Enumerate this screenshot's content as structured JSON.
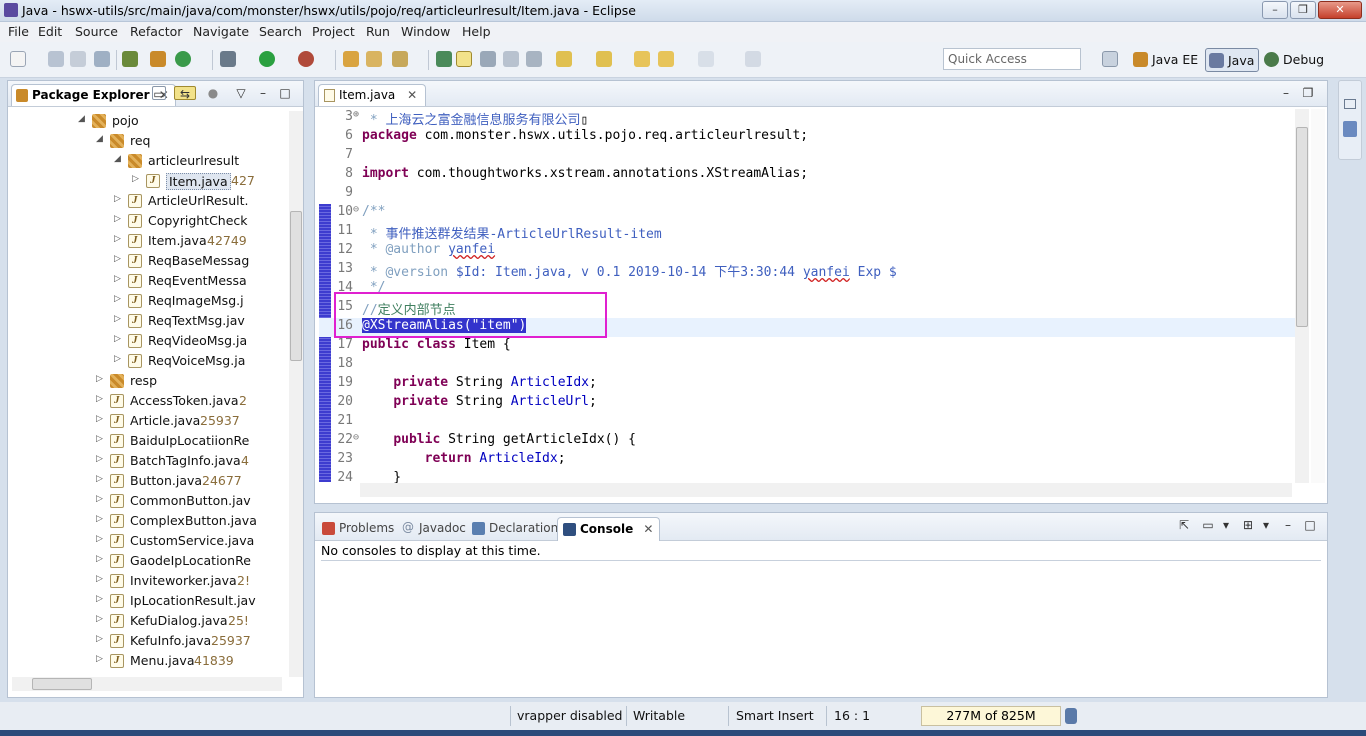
{
  "window": {
    "title": "Java - hswx-utils/src/main/java/com/monster/hswx/utils/pojo/req/articleurlresult/Item.java - Eclipse",
    "controls": {
      "minimize": "–",
      "maximize": "❐",
      "close": "✕"
    }
  },
  "menu": [
    "File",
    "Edit",
    "Source",
    "Refactor",
    "Navigate",
    "Search",
    "Project",
    "Run",
    "Window",
    "Help"
  ],
  "quick_access": {
    "placeholder": "Quick Access"
  },
  "perspectives": [
    {
      "label": "Java EE",
      "active": false
    },
    {
      "label": "Java",
      "active": true
    },
    {
      "label": "Debug",
      "active": false
    }
  ],
  "package_explorer": {
    "title": "Package Explorer",
    "items": [
      {
        "label": "pojo",
        "meta": "",
        "kind": "pkg",
        "arrow": "◢",
        "indent": 1
      },
      {
        "label": "req",
        "meta": "",
        "kind": "pkg",
        "arrow": "◢",
        "indent": 2
      },
      {
        "label": "articleurlresult",
        "meta": "",
        "kind": "pkg",
        "arrow": "◢",
        "indent": 3
      },
      {
        "label": "Item.java",
        "meta": " 427",
        "kind": "jf",
        "arrow": "▷",
        "indent": 4,
        "selected": true
      },
      {
        "label": "ArticleUrlResult.",
        "meta": "",
        "kind": "jf",
        "arrow": "▷",
        "indent": 3
      },
      {
        "label": "CopyrightCheck",
        "meta": "",
        "kind": "jf",
        "arrow": "▷",
        "indent": 3
      },
      {
        "label": "Item.java",
        "meta": " 42749",
        "kind": "jf",
        "arrow": "▷",
        "indent": 3
      },
      {
        "label": "ReqBaseMessag",
        "meta": "",
        "kind": "jf",
        "arrow": "▷",
        "indent": 3
      },
      {
        "label": "ReqEventMessa",
        "meta": "",
        "kind": "jf",
        "arrow": "▷",
        "indent": 3
      },
      {
        "label": "ReqImageMsg.j",
        "meta": "",
        "kind": "jf",
        "arrow": "▷",
        "indent": 3
      },
      {
        "label": "ReqTextMsg.jav",
        "meta": "",
        "kind": "jf",
        "arrow": "▷",
        "indent": 3
      },
      {
        "label": "ReqVideoMsg.ja",
        "meta": "",
        "kind": "jf",
        "arrow": "▷",
        "indent": 3
      },
      {
        "label": "ReqVoiceMsg.ja",
        "meta": "",
        "kind": "jf",
        "arrow": "▷",
        "indent": 3
      },
      {
        "label": "resp",
        "meta": "",
        "kind": "pkg",
        "arrow": "▷",
        "indent": 2
      },
      {
        "label": "AccessToken.java",
        "meta": " 2",
        "kind": "jf",
        "arrow": "▷",
        "indent": 2
      },
      {
        "label": "Article.java",
        "meta": " 25937",
        "kind": "jf",
        "arrow": "▷",
        "indent": 2
      },
      {
        "label": "BaiduIpLocatiionRe",
        "meta": "",
        "kind": "jf",
        "arrow": "▷",
        "indent": 2
      },
      {
        "label": "BatchTagInfo.java",
        "meta": " 4",
        "kind": "jf",
        "arrow": "▷",
        "indent": 2
      },
      {
        "label": "Button.java",
        "meta": " 24677",
        "kind": "jf",
        "arrow": "▷",
        "indent": 2
      },
      {
        "label": "CommonButton.jav",
        "meta": "",
        "kind": "jf",
        "arrow": "▷",
        "indent": 2
      },
      {
        "label": "ComplexButton.java",
        "meta": "",
        "kind": "jf",
        "arrow": "▷",
        "indent": 2
      },
      {
        "label": "CustomService.java",
        "meta": "",
        "kind": "jf",
        "arrow": "▷",
        "indent": 2
      },
      {
        "label": "GaodeIpLocationRe",
        "meta": "",
        "kind": "jf",
        "arrow": "▷",
        "indent": 2
      },
      {
        "label": "Inviteworker.java",
        "meta": " 2!",
        "kind": "jf",
        "arrow": "▷",
        "indent": 2
      },
      {
        "label": "IpLocationResult.jav",
        "meta": "",
        "kind": "jf",
        "arrow": "▷",
        "indent": 2
      },
      {
        "label": "KefuDialog.java",
        "meta": " 25!",
        "kind": "jf",
        "arrow": "▷",
        "indent": 2
      },
      {
        "label": "KefuInfo.java",
        "meta": " 25937",
        "kind": "jf",
        "arrow": "▷",
        "indent": 2
      },
      {
        "label": "Menu.java",
        "meta": " 41839",
        "kind": "jf",
        "arrow": "▷",
        "indent": 2
      }
    ]
  },
  "editor": {
    "tab_label": "Item.java",
    "lines": [
      {
        "n": "3",
        "fold": "⊕",
        "html": "<span class=\"jd\"> * </span><span class=\"cm\">上海云之富金融信息服务有限公司</span>▯"
      },
      {
        "n": "6",
        "fold": "",
        "html": "<span class=\"kw\">package</span> com.monster.hswx.utils.pojo.req.articleurlresult;"
      },
      {
        "n": "7",
        "fold": "",
        "html": ""
      },
      {
        "n": "8",
        "fold": "",
        "html": "<span class=\"kw\">import</span> com.thoughtworks.xstream.annotations.XStreamAlias;"
      },
      {
        "n": "9",
        "fold": "",
        "html": ""
      },
      {
        "n": "10",
        "fold": "⊖",
        "html": "<span class=\"jd\">/**</span>"
      },
      {
        "n": "11",
        "fold": "",
        "html": "<span class=\"jd\"> * </span><span class=\"cm\">事件推送群发结果-ArticleUrlResult-item</span>"
      },
      {
        "n": "12",
        "fold": "",
        "html": "<span class=\"jd\"> * @author </span><span class=\"cm squig\">yanfei</span>"
      },
      {
        "n": "13",
        "fold": "",
        "html": "<span class=\"jd\"> * @version </span><span class=\"cm\">$Id: Item.java, v 0.1 2019-10-14 下午3:30:44 <span class=\"squig\">yanfei</span> Exp $</span>"
      },
      {
        "n": "14",
        "fold": "",
        "html": "<span class=\"jd\"> */</span>"
      },
      {
        "n": "15",
        "fold": "",
        "html": "<span class=\"jd\">//</span><span style=\"color:#3f7f5f\">定义内部节点</span>"
      },
      {
        "n": "16",
        "fold": "",
        "html": "<span class=\"sel\">@XStreamAlias(\"item\")</span>",
        "current": true
      },
      {
        "n": "17",
        "fold": "",
        "html": "<span class=\"kw\">public class</span> Item {"
      },
      {
        "n": "18",
        "fold": "",
        "html": ""
      },
      {
        "n": "19",
        "fold": "",
        "html": "    <span class=\"kw\">private</span> String <span class=\"field\">ArticleIdx</span>;"
      },
      {
        "n": "20",
        "fold": "",
        "html": "    <span class=\"kw\">private</span> String <span class=\"field\">ArticleUrl</span>;"
      },
      {
        "n": "21",
        "fold": "",
        "html": ""
      },
      {
        "n": "22",
        "fold": "⊖",
        "html": "    <span class=\"kw\">public</span> String getArticleIdx() {"
      },
      {
        "n": "23",
        "fold": "",
        "html": "        <span class=\"kw\">return</span> <span class=\"field\">ArticleIdx</span>;"
      },
      {
        "n": "24",
        "fold": "",
        "html": "    }"
      }
    ]
  },
  "console": {
    "tabs": [
      {
        "label": "Problems",
        "active": false,
        "color": "#c94a3a"
      },
      {
        "label": "Javadoc",
        "active": false,
        "color": "#7a8aa0"
      },
      {
        "label": "Declaration",
        "active": false,
        "color": "#5a7fb0"
      },
      {
        "label": "Console",
        "active": true,
        "color": "#2f4f7f"
      }
    ],
    "message": "No consoles to display at this time."
  },
  "status": {
    "wrapper": "vrapper disabled",
    "mode": "Writable",
    "insert": "Smart Insert",
    "position": "16 : 1",
    "heap": "277M of 825M"
  }
}
